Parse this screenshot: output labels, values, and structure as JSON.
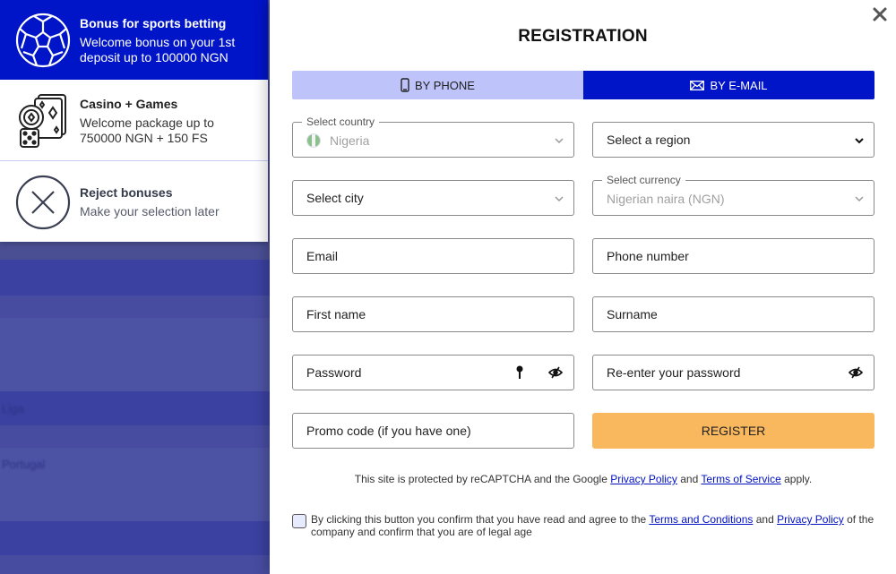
{
  "background": {
    "labels": [
      "Liga",
      "Portugal"
    ]
  },
  "bonuses": [
    {
      "title": "Bonus for sports betting",
      "description": "Welcome bonus on your 1st deposit up to 100000 NGN",
      "icon": "soccer-ball-icon",
      "selected": true
    },
    {
      "title": "Casino + Games",
      "description": "Welcome package up to 750000 NGN + 150 FS",
      "icon": "casino-chips-cards-dice-icon",
      "selected": false
    },
    {
      "title": "Reject bonuses",
      "description": "Make your selection later",
      "icon": "reject-x-circle-icon",
      "selected": false
    }
  ],
  "modal": {
    "title": "REGISTRATION",
    "close_icon": "close-icon",
    "tabs": [
      {
        "label": "BY PHONE",
        "icon": "phone-icon",
        "active": false
      },
      {
        "label": "BY E-MAIL",
        "icon": "envelope-icon",
        "active": true
      }
    ],
    "fields": {
      "country": {
        "legend": "Select country",
        "value": "Nigeria",
        "flag": "nigeria-flag"
      },
      "region": {
        "placeholder": "Select a region"
      },
      "city": {
        "placeholder": "Select city"
      },
      "currency": {
        "legend": "Select currency",
        "value": "Nigerian naira (NGN)"
      },
      "email": {
        "placeholder": "Email"
      },
      "phone": {
        "placeholder": "Phone number"
      },
      "first_name": {
        "placeholder": "First name"
      },
      "surname": {
        "placeholder": "Surname"
      },
      "password": {
        "placeholder": "Password"
      },
      "password_confirm": {
        "placeholder": "Re-enter your password"
      },
      "promo": {
        "placeholder": "Promo code (if you have one)"
      }
    },
    "register_label": "REGISTER",
    "captcha": {
      "prefix": "This site is protected by reCAPTCHA and the Google ",
      "privacy_link": "Privacy Policy",
      "and": " and ",
      "terms_link": "Terms of Service",
      "suffix": " apply."
    },
    "agreement": {
      "checked": false,
      "prefix": "By clicking this button you confirm that you have read and agree to the ",
      "terms_link": "Terms and Conditions",
      "and": " and ",
      "privacy_link": "Privacy Policy",
      "suffix": " of the company and confirm that you are of legal age"
    }
  },
  "colors": {
    "brand_blue": "#0014c8",
    "tab_inactive": "#bec3fa",
    "register_button": "#f9b85e",
    "link": "#0010c0"
  }
}
